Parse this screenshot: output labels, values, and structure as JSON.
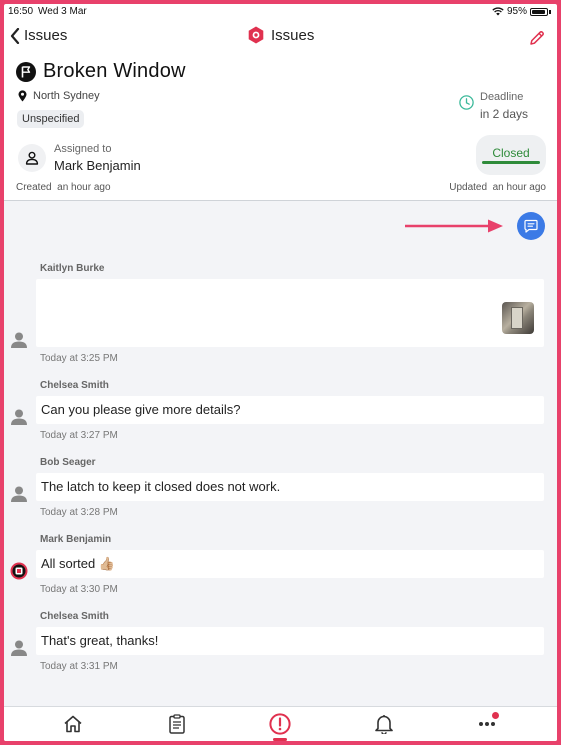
{
  "status_bar": {
    "time": "16:50",
    "date": "Wed 3 Mar",
    "battery": "95%"
  },
  "nav": {
    "back_label": "Issues",
    "title": "Issues",
    "icons": {
      "back": "chevron-left-icon",
      "title": "issues-hexagon-icon",
      "edit": "pencil-icon"
    }
  },
  "issue": {
    "title": "Broken Window",
    "location": "North Sydney",
    "tag": "Unspecified",
    "deadline_label": "Deadline",
    "deadline_value": "in 2 days",
    "assigned_label": "Assigned to",
    "assigned_value": "Mark Benjamin",
    "status": "Closed",
    "created_label": "Created",
    "created_value": "an hour ago",
    "updated_label": "Updated",
    "updated_value": "an hour ago"
  },
  "messages": [
    {
      "author": "Kaitlyn Burke",
      "text": "",
      "has_photo": true,
      "time": "Today at 3:25 PM"
    },
    {
      "author": "Chelsea Smith",
      "text": "Can you please give more details?",
      "time": "Today at 3:27 PM"
    },
    {
      "author": "Bob Seager",
      "text": "The latch to keep it closed does not work.",
      "time": "Today at 3:28 PM"
    },
    {
      "author": "Mark Benjamin",
      "text": "All sorted 👍🏼",
      "time": "Today at 3:30 PM"
    },
    {
      "author": "Chelsea Smith",
      "text": "That's great, thanks!",
      "time": "Today at 3:31 PM"
    }
  ],
  "tabs": [
    {
      "name": "home",
      "icon": "home-icon"
    },
    {
      "name": "checklist",
      "icon": "clipboard-list-icon"
    },
    {
      "name": "issues",
      "icon": "alert-circle-icon",
      "active": true
    },
    {
      "name": "notifications",
      "icon": "bell-icon"
    },
    {
      "name": "more",
      "icon": "more-dots-icon",
      "badge": true
    }
  ],
  "colors": {
    "accent": "#e0314f",
    "frame": "#e8416b",
    "closed": "#2e8b3a",
    "chat_button": "#3b7ae6",
    "chat_bg": "#f3f4f7"
  }
}
